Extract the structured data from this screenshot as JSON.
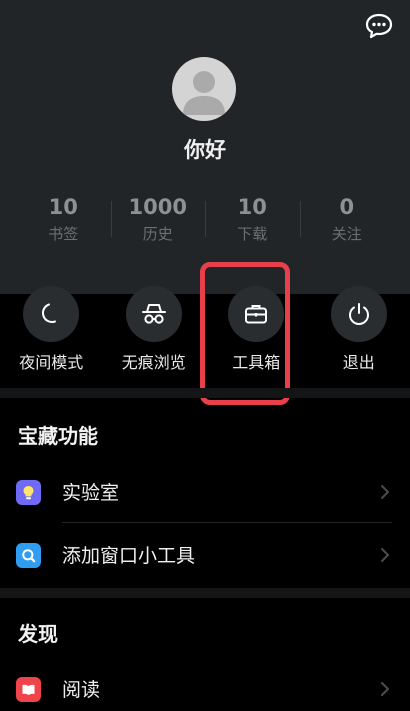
{
  "profile": {
    "name": "你好"
  },
  "stats": [
    {
      "value": "10",
      "label": "书签"
    },
    {
      "value": "1000",
      "label": "历史"
    },
    {
      "value": "10",
      "label": "下载"
    },
    {
      "value": "0",
      "label": "关注"
    }
  ],
  "quick_actions": [
    {
      "label": "夜间模式",
      "icon": "moon-icon"
    },
    {
      "label": "无痕浏览",
      "icon": "incognito-icon"
    },
    {
      "label": "工具箱",
      "icon": "toolbox-icon"
    },
    {
      "label": "退出",
      "icon": "power-icon"
    }
  ],
  "sections": {
    "treasure": {
      "title": "宝藏功能",
      "items": [
        {
          "label": "实验室",
          "icon": "lab-bulb-icon",
          "color": "#6e6af5"
        },
        {
          "label": "添加窗口小工具",
          "icon": "widget-search-icon",
          "color": "#2f9df2"
        }
      ]
    },
    "discover": {
      "title": "发现",
      "items": [
        {
          "label": "阅读",
          "icon": "book-icon",
          "color": "#f0444c"
        }
      ]
    }
  },
  "colors": {
    "highlight": "#e8404a",
    "header_bg": "#222527"
  }
}
